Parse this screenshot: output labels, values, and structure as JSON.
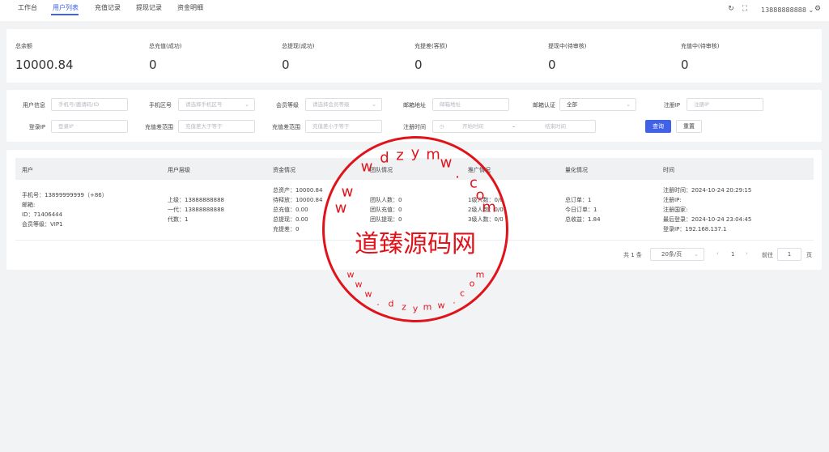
{
  "tabs": [
    {
      "label": "工作台",
      "active": false
    },
    {
      "label": "用户列表",
      "active": true
    },
    {
      "label": "充值记录",
      "active": false
    },
    {
      "label": "提现记录",
      "active": false
    },
    {
      "label": "资金明细",
      "active": false
    }
  ],
  "header": {
    "username": "13888888888"
  },
  "stats": [
    {
      "label": "总余额",
      "value": "10000.84"
    },
    {
      "label": "总充值(成功)",
      "value": "0"
    },
    {
      "label": "总提现(成功)",
      "value": "0"
    },
    {
      "label": "充提差(客损)",
      "value": "0"
    },
    {
      "label": "提现中(待审核)",
      "value": "0"
    },
    {
      "label": "充值中(待审核)",
      "value": "0"
    }
  ],
  "filters": {
    "user_info": {
      "label": "用户信息",
      "placeholder": "手机号/邀请码/ID"
    },
    "phone_region": {
      "label": "手机区号",
      "placeholder": "请选择手机区号"
    },
    "member_level": {
      "label": "会员等级",
      "placeholder": "请选择会员等级"
    },
    "email": {
      "label": "邮箱地址",
      "placeholder": "邮箱地址"
    },
    "email_verify": {
      "label": "邮箱认证",
      "value": "全部"
    },
    "register_ip": {
      "label": "注册IP",
      "placeholder": "注册IP"
    },
    "login_ip": {
      "label": "登录IP",
      "placeholder": "登录IP"
    },
    "recharge_gt": {
      "label": "充值差范围",
      "placeholder": "充值差大于等于"
    },
    "recharge_lt": {
      "label": "充值差范围",
      "placeholder": "充值差小于等于"
    },
    "register_time": {
      "label": "注册时间",
      "start_placeholder": "开始时间",
      "separator": "–",
      "end_placeholder": "结束时间"
    },
    "search_label": "查询",
    "reset_label": "重置"
  },
  "table": {
    "headers": [
      "用户",
      "用户层级",
      "资金情况",
      "团队情况",
      "推广情况",
      "量化情况",
      "时间"
    ],
    "row": {
      "user": [
        "手机号：13899999999（+86）",
        "邮箱:",
        "ID：71406444",
        "会员等级：VIP1"
      ],
      "level": [
        "上级：13888888888",
        "一代：13888888888",
        "代数：1"
      ],
      "funds": [
        "总资产：10000.84",
        "待释放：10000.84",
        "总充值：0.00",
        "总提现：0.00",
        "充提差：0"
      ],
      "team": [
        "团队人数：0",
        "团队充值：0",
        "团队提现：0"
      ],
      "promo": [
        "1级人数：0/0",
        "2级人数：0/0",
        "3级人数：0/0"
      ],
      "quant": [
        "总订单：1",
        "今日订单：1",
        "总收益：1.84"
      ],
      "time": [
        "注册时间：2024-10-24 20:29:15",
        "注册IP:",
        "注册国家:",
        "最后登录：2024-10-24 23:04:45",
        "登录IP：192.168.137.1"
      ]
    }
  },
  "pagination": {
    "total": "共 1 条",
    "page_size": "20条/页",
    "prev": "‹",
    "current": "1",
    "next": "›",
    "goto_label": "前往",
    "goto_value": "1",
    "page_suffix": "页"
  },
  "watermark": {
    "title": "道臻源码网",
    "chars": [
      "d",
      "z",
      "y",
      "m",
      "w",
      ".",
      "c",
      "o",
      "m",
      "w",
      "w",
      "w"
    ],
    "chars_bottom": [
      "w",
      "w",
      "w",
      ".",
      "d",
      "z",
      "y",
      "m",
      "w",
      ".",
      "c",
      "o",
      "m"
    ]
  },
  "icons": {
    "refresh": "refresh-icon",
    "fullscreen": "fullscreen-icon",
    "settings": "gear-icon"
  },
  "colors": {
    "accent": "#3f62e6",
    "seal": "#e0131b"
  }
}
